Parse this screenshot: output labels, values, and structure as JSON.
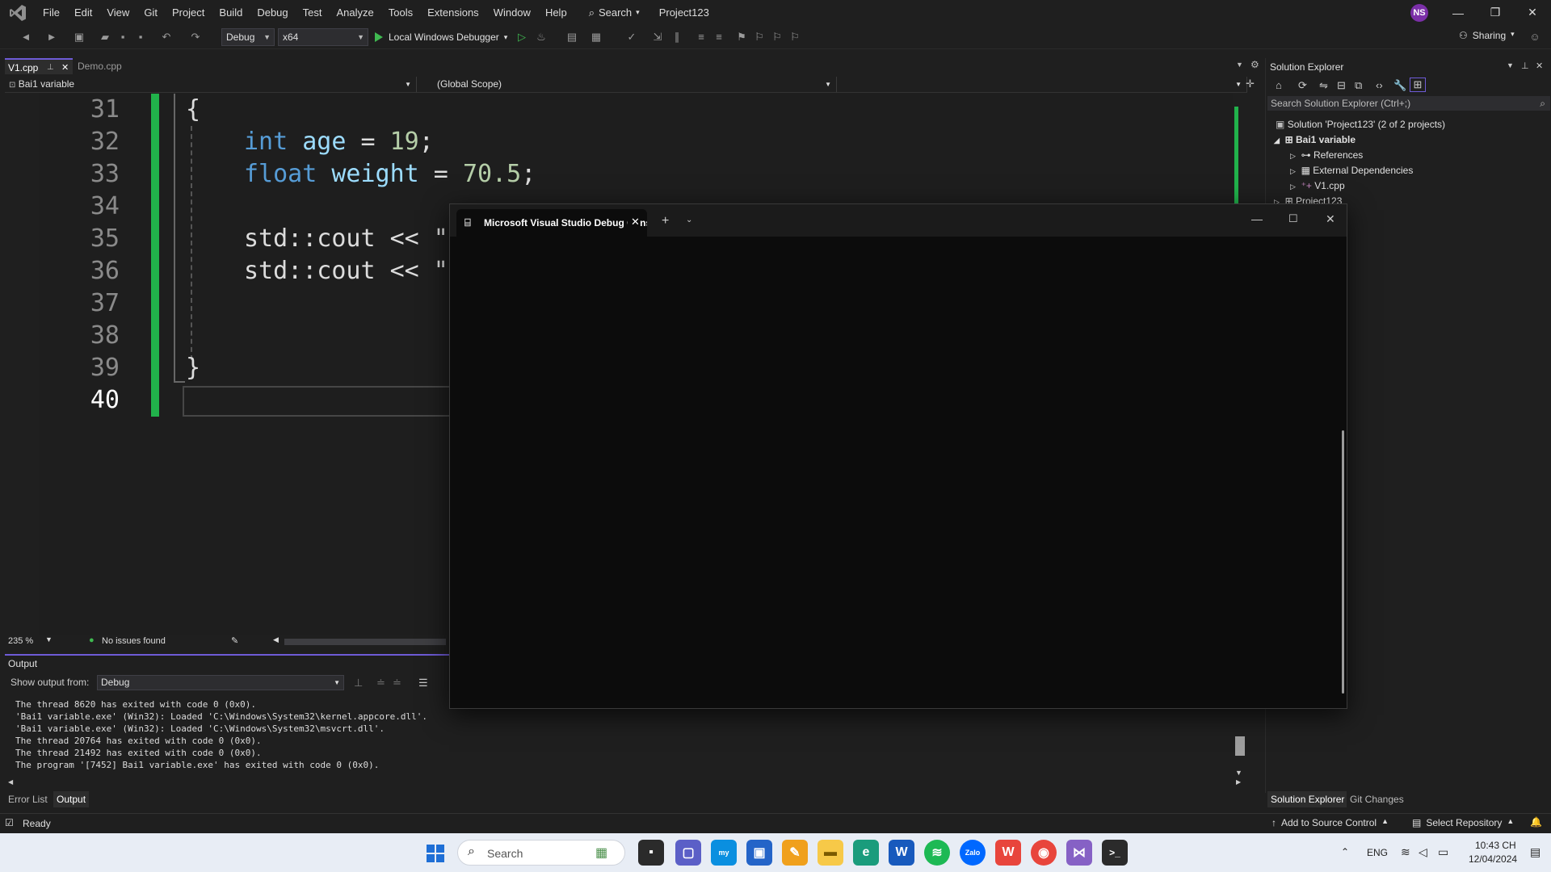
{
  "menubar": {
    "items": [
      "File",
      "Edit",
      "View",
      "Git",
      "Project",
      "Build",
      "Debug",
      "Test",
      "Analyze",
      "Tools",
      "Extensions",
      "Window",
      "Help"
    ],
    "search_label": "Search",
    "project_title": "Project123",
    "user_initials": "NS"
  },
  "toolbar": {
    "config": "Debug",
    "platform": "x64",
    "debugger_label": "Local Windows Debugger",
    "sharing_label": "Sharing"
  },
  "doc_tabs": [
    {
      "label": "V1.cpp",
      "active": true
    },
    {
      "label": "Demo.cpp",
      "active": false
    }
  ],
  "navbar": {
    "project": "Bai1 variable",
    "scope": "(Global Scope)"
  },
  "editor": {
    "line_numbers": [
      "31",
      "32",
      "33",
      "34",
      "35",
      "36",
      "37",
      "38",
      "39",
      "40"
    ],
    "code": {
      "l31": "{",
      "l32_type": "int",
      "l32_name": "age",
      "l32_eq": " = ",
      "l32_val": "19",
      "l32_end": ";",
      "l33_type": "float",
      "l33_name": "weight",
      "l33_eq": " = ",
      "l33_val": "70.5",
      "l33_end": ";",
      "l35": "std::cout << \"",
      "l36": "std::cout << \"",
      "l39": "}"
    },
    "zoom": "235 %",
    "issues": "No issues found"
  },
  "output": {
    "title": "Output",
    "show_from_label": "Show output from:",
    "source": "Debug",
    "lines": [
      "The thread 8620 has exited with code 0 (0x0).",
      "'Bai1 variable.exe' (Win32): Loaded 'C:\\Windows\\System32\\kernel.appcore.dll'.",
      "'Bai1 variable.exe' (Win32): Loaded 'C:\\Windows\\System32\\msvcrt.dll'.",
      "The thread 20764 has exited with code 0 (0x0).",
      "The thread 21492 has exited with code 0 (0x0).",
      "The program '[7452] Bai1 variable.exe' has exited with code 0 (0x0)."
    ]
  },
  "bottom_tabs": [
    "Error List",
    "Output"
  ],
  "solution_explorer": {
    "title": "Solution Explorer",
    "search_placeholder": "Search Solution Explorer (Ctrl+;)",
    "solution": "Solution 'Project123' (2 of 2 projects)",
    "project": "Bai1 variable",
    "children": [
      "References",
      "External Dependencies",
      "V1.cpp"
    ],
    "project2": "Project123",
    "tabs": [
      "Solution Explorer",
      "Git Changes"
    ]
  },
  "console": {
    "tab_title": "Microsoft Visual Studio Debug Console"
  },
  "statusbar": {
    "ready": "Ready",
    "source_control": "Add to Source Control",
    "repository": "Select Repository"
  },
  "taskbar": {
    "search_label": "Search",
    "lang": "ENG",
    "time": "10:43 CH",
    "date": "12/04/2024"
  },
  "colors": {
    "accent": "#6e5bd6",
    "change_bar": "#21b24b",
    "keyword": "#569cd6",
    "variable": "#9cdcfe",
    "number": "#b5cea8"
  }
}
